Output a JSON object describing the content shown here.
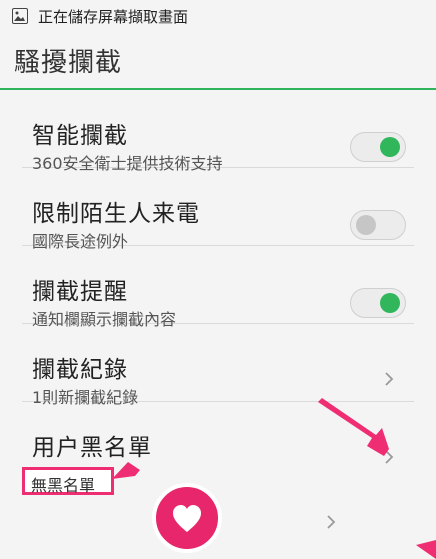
{
  "status_bar": {
    "text": "正在儲存屏幕擷取畫面",
    "icon": "image-icon"
  },
  "header": {
    "title": "騷擾攔截"
  },
  "items": [
    {
      "title": "智能攔截",
      "subtitle": "360安全衛士提供技術支持",
      "control": "toggle",
      "state": "on"
    },
    {
      "title": "限制陌生人来電",
      "subtitle": "國際長途例外",
      "control": "toggle",
      "state": "off"
    },
    {
      "title": "攔截提醒",
      "subtitle": "通知欄顯示攔截內容",
      "control": "toggle",
      "state": "on"
    },
    {
      "title": "攔截紀錄",
      "subtitle": "1則新攔截紀錄",
      "control": "chevron"
    },
    {
      "title": "用户黑名單",
      "subtitle": "無黑名單",
      "control": "chevron"
    }
  ],
  "colors": {
    "accent": "#32b65c",
    "annotation": "#ef2d72"
  }
}
